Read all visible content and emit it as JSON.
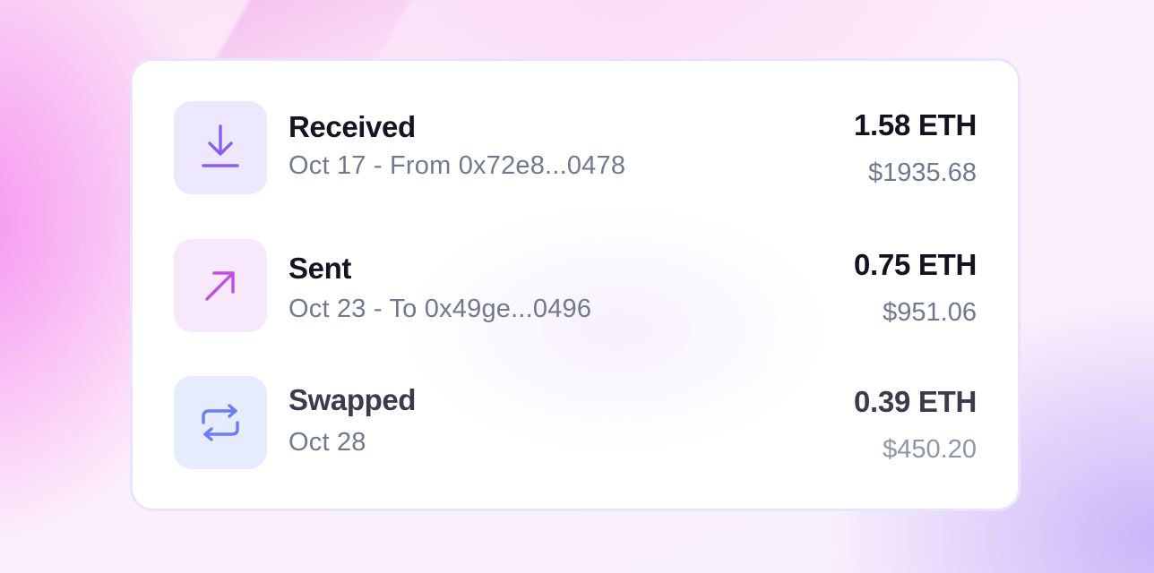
{
  "transactions": [
    {
      "type": "Received",
      "details": "Oct 17 - From 0x72e8...0478",
      "amount": "1.58 ETH",
      "fiat": "$1935.68",
      "icon": "download-arrow-icon",
      "accent": "#8b5cf6"
    },
    {
      "type": "Sent",
      "details": "Oct 23 - To 0x49ge...0496",
      "amount": "0.75 ETH",
      "fiat": "$951.06",
      "icon": "arrow-up-right-icon",
      "accent": "#c04ee0"
    },
    {
      "type": "Swapped",
      "details": "Oct 28",
      "amount": "0.39 ETH",
      "fiat": "$450.20",
      "icon": "swap-arrows-icon",
      "accent": "#6b7cf4"
    }
  ]
}
